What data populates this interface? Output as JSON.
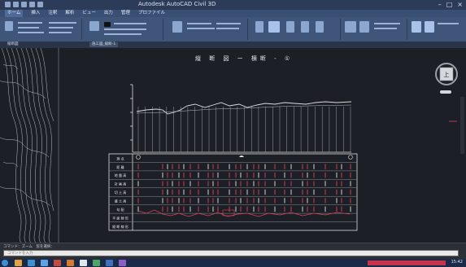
{
  "window": {
    "title": "Autodesk AutoCAD Civil 3D"
  },
  "ribbon_tabs": [
    "ホーム",
    "挿入",
    "注釈",
    "解析",
    "ビュー",
    "出力",
    "管理",
    "プロファイル"
  ],
  "doc_tabs": [
    "縦断図",
    "施工図_縦断-1"
  ],
  "drawing": {
    "sheet_title": "縦 断 図 ー 横断 - ①"
  },
  "viewcube": {
    "label": "上"
  },
  "row_labels": [
    "測 点",
    "距 離",
    "地 盤 高",
    "計 画 高",
    "切 土 高",
    "盛 土 高",
    "勾 配",
    "平 面 線 形",
    "縦 断 線 形"
  ],
  "command": {
    "history": "コマンド：ズーム　窓を選択：",
    "placeholder": "コマンドを入力"
  },
  "taskbar": {
    "tray_text": "15:42"
  },
  "colors": {
    "ribbon": "#3f5579",
    "canvas": "#1c1f25",
    "profile_line": "#dcdcdc",
    "accent_red": "#e0405a"
  }
}
